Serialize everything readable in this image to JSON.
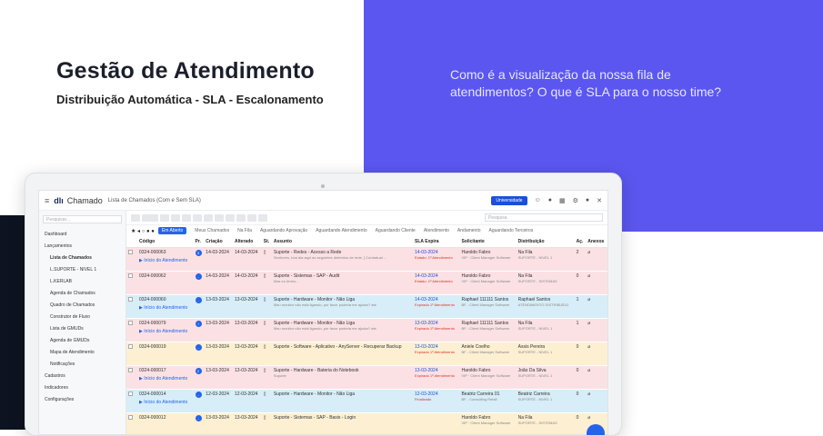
{
  "hero": {
    "title": "Gestão de Atendimento",
    "subtitle": "Distribuição Automática - SLA - Escalonamento",
    "question": "Como é a visualização da nossa fila de atendimentos? O que é SLA para o nosso time?"
  },
  "app": {
    "brand": "Chamado",
    "breadcrumb": "Lista de Chamados (Com e Sem SLA)",
    "university_button": "Universidade",
    "search_placeholder": "Pesquisar...",
    "top_search_placeholder": "Pesquisa"
  },
  "sidebar": {
    "items": [
      "Dashboard",
      "Lançamentos",
      "Lista de Chamados",
      "L.SUPORTE - NIVEL 1",
      "L.KERLAB",
      "Agenda de Chamados",
      "Quadro de Chamados",
      "Construtor de Fluxo",
      "Lista de GMUDs",
      "Agenda de GMUDs",
      "Mapa de Atendimento",
      "Notificações",
      "Cadastros",
      "Indicadores",
      "Configurações"
    ]
  },
  "tabs": [
    "Em Aberto",
    "Meus Chamados",
    "Na Fila",
    "Aguardando Aprovação",
    "Aguardando Atendimento",
    "Aguardando Cliente",
    "Atendimento",
    "Andamento",
    "Aguardando Terceiros"
  ],
  "columns": [
    "Código",
    "Pr.",
    "Criação",
    "Alterado",
    "St.",
    "Assunto",
    "SLA Expira",
    "Solicitante",
    "Distribuição",
    "Aç.",
    "Anexos"
  ],
  "rows": [
    {
      "code": "0324-000063",
      "link": "Início do Atendimento",
      "pri": "3",
      "created": "14-03-2024",
      "altered": "14-03-2024",
      "subject": "Suporte - Redes - Acesso a Rede",
      "detail": "Senhores, boa dia aqui as seguintes diretórios de rede, [ Contratual ...",
      "sla": "14-03-2024",
      "sla_sub": "Estado: 1º Atendimento",
      "req": "Haroldo Fabro",
      "req_sub": "VIP · Client Manager Software",
      "dist": "Na Fila",
      "dist_sub": "SUPORTE - NIVEL 1",
      "n": "2",
      "style": "r-pink"
    },
    {
      "code": "0324-000062",
      "link": "",
      "pri": "-",
      "created": "14-03-2024",
      "altered": "14-03-2024",
      "subject": "Suporte - Sistemas - SAP - Audit",
      "detail": "Mas eu tenho...",
      "sla": "14-03-2024",
      "sla_sub": "Estado: 1º Atendimento",
      "req": "Haroldo Fabro",
      "req_sub": "VIP · Client Manager Software",
      "dist": "Na Fila",
      "dist_sub": "SUPORTE - SISTEMAS",
      "n": "0",
      "style": "r-pink"
    },
    {
      "code": "0324-000060",
      "link": "Início do Atendimento",
      "pri": "-",
      "created": "13-03-2024",
      "altered": "13-03-2024",
      "subject": "Suporte - Hardware - Monitor - Não Liga",
      "detail": "Meu monitor não está ligando, por favor poderia me ajudar? ate",
      "sla": "14-03-2024",
      "sla_sub": "Expirado 1º Atendimento",
      "req": "Raphael 111111 Santos",
      "req_sub": "BF - Client Manager Software",
      "dist": "Raphael Santos",
      "dist_sub": "ATENDIMENTO DISTRIBUÍDO",
      "n": "1",
      "style": "r-blue"
    },
    {
      "code": "0324-000079",
      "link": "Início do Atendimento",
      "pri": "!",
      "created": "13-03-2024",
      "altered": "13-03-2024",
      "subject": "Suporte - Hardware - Monitor - Não Liga",
      "detail": "Meu monitor não está ligando, por favor poderia me ajudar? ate",
      "sla": "13-03-2024",
      "sla_sub": "Expirado 1º Atendimento",
      "req": "Raphael 111111 Santos",
      "req_sub": "BF - Client Manager Software",
      "dist": "Na Fila",
      "dist_sub": "SUPORTE - NIVEL 1",
      "n": "1",
      "style": "r-pink"
    },
    {
      "code": "0324-000019",
      "link": "",
      "pri": "-",
      "created": "13-03-2024",
      "altered": "13-03-2024",
      "subject": "Suporte - Software - Aplicativo - AnyServer - Recuperar Backup",
      "detail": "",
      "sla": "13-03-2024",
      "sla_sub": "Expirado 1º Atendimento",
      "req": "Aniele Coelho",
      "req_sub": "BF - Client Manager Software",
      "dist": "Assis Pereira",
      "dist_sub": "SUPORTE - NIVEL 1",
      "n": "0",
      "style": "r-yel"
    },
    {
      "code": "0324-000017",
      "link": "Início do Atendimento",
      "pri": "2",
      "created": "13-03-2024",
      "altered": "13-03-2024",
      "subject": "Suporte - Hardware - Bateria do Notebook",
      "detail": "Suporte",
      "sla": "13-03-2024",
      "sla_sub": "Expirado 1º Atendimento",
      "req": "Haroldo Fabro",
      "req_sub": "VIP · Client Manager Software",
      "dist": "João Da Silva",
      "dist_sub": "SUPORTE - NIVEL 1",
      "n": "0",
      "style": "r-pink"
    },
    {
      "code": "0324-000014",
      "link": "Início do Atendimento",
      "pri": "-",
      "created": "12-03-2024",
      "altered": "12-03-2024",
      "subject": "Suporte - Hardware - Monitor - Não Liga",
      "detail": "",
      "sla": "12-03-2024",
      "sla_sub": "Finalizado",
      "req": "Beatriz Carreira 01",
      "req_sub": "BF - Consulting Retail",
      "dist": "Beatriz Carreira",
      "dist_sub": "SUPORTE - NIVEL 1",
      "n": "0",
      "style": "r-blue"
    },
    {
      "code": "0324-000012",
      "link": "",
      "pri": "-",
      "created": "13-03-2024",
      "altered": "13-03-2024",
      "subject": "Suporte - Sistemas - SAP - Basis - Login",
      "detail": "",
      "sla": "",
      "sla_sub": "",
      "req": "Haroldo Fabro",
      "req_sub": "VIP · Client Manager Software",
      "dist": "Na Fila",
      "dist_sub": "SUPORTE - SISTEMAS",
      "n": "0",
      "style": "r-yel"
    }
  ]
}
